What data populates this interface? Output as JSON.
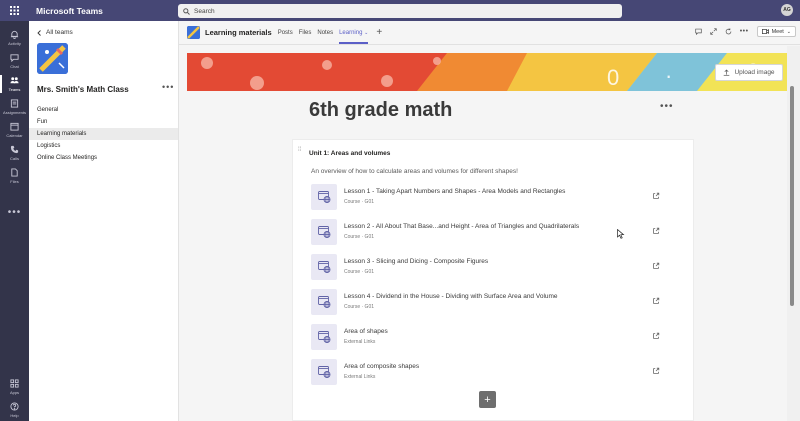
{
  "app": {
    "title": "Microsoft Teams"
  },
  "search": {
    "placeholder": "Search"
  },
  "user": {
    "initials": "AG"
  },
  "rail": [
    {
      "label": "Activity",
      "icon": "bell-icon"
    },
    {
      "label": "Chat",
      "icon": "chat-icon"
    },
    {
      "label": "Teams",
      "icon": "teams-icon"
    },
    {
      "label": "Assignments",
      "icon": "assignments-icon"
    },
    {
      "label": "Calendar",
      "icon": "calendar-icon"
    },
    {
      "label": "Calls",
      "icon": "phone-icon"
    },
    {
      "label": "Files",
      "icon": "file-icon"
    }
  ],
  "rail_bottom": [
    {
      "label": "Apps",
      "icon": "apps-icon"
    },
    {
      "label": "Help",
      "icon": "help-icon"
    }
  ],
  "sidebar": {
    "back_label": "All teams",
    "team_name": "Mrs. Smith's Math Class",
    "channels": [
      "General",
      "Fun",
      "Learning materials",
      "Logistics",
      "Online Class Meetings"
    ],
    "active_channel": "Learning materials"
  },
  "channel_header": {
    "title": "Learning materials",
    "tabs": [
      "Posts",
      "Files",
      "Notes",
      "Learning"
    ],
    "active_tab": "Learning",
    "meet_label": "Meet"
  },
  "banner": {
    "upload_label": "Upload image"
  },
  "page": {
    "title": "6th grade math"
  },
  "unit": {
    "title": "Unit 1: Areas and volumes",
    "description": "An overview of how to calculate areas and volumes for different shapes!",
    "lessons": [
      {
        "title": "Lesson 1 - Taking Apart Numbers and Shapes - Area Models and Rectangles",
        "subtitle": "Course · G01"
      },
      {
        "title": "Lesson 2 - All About That Base...and Height - Area of Triangles and Quadrilaterals",
        "subtitle": "Course · G01"
      },
      {
        "title": "Lesson 3 - Slicing and Dicing - Composite Figures",
        "subtitle": "Course · G01"
      },
      {
        "title": "Lesson 4 - Dividend in the House - Dividing with Surface Area and Volume",
        "subtitle": "Course · G01"
      },
      {
        "title": "Area of shapes",
        "subtitle": "External Links"
      },
      {
        "title": "Area of composite shapes",
        "subtitle": "External Links"
      }
    ]
  },
  "colors": {
    "brand": "#464775",
    "rail": "#33344a",
    "accent": "#5b5fc7"
  }
}
